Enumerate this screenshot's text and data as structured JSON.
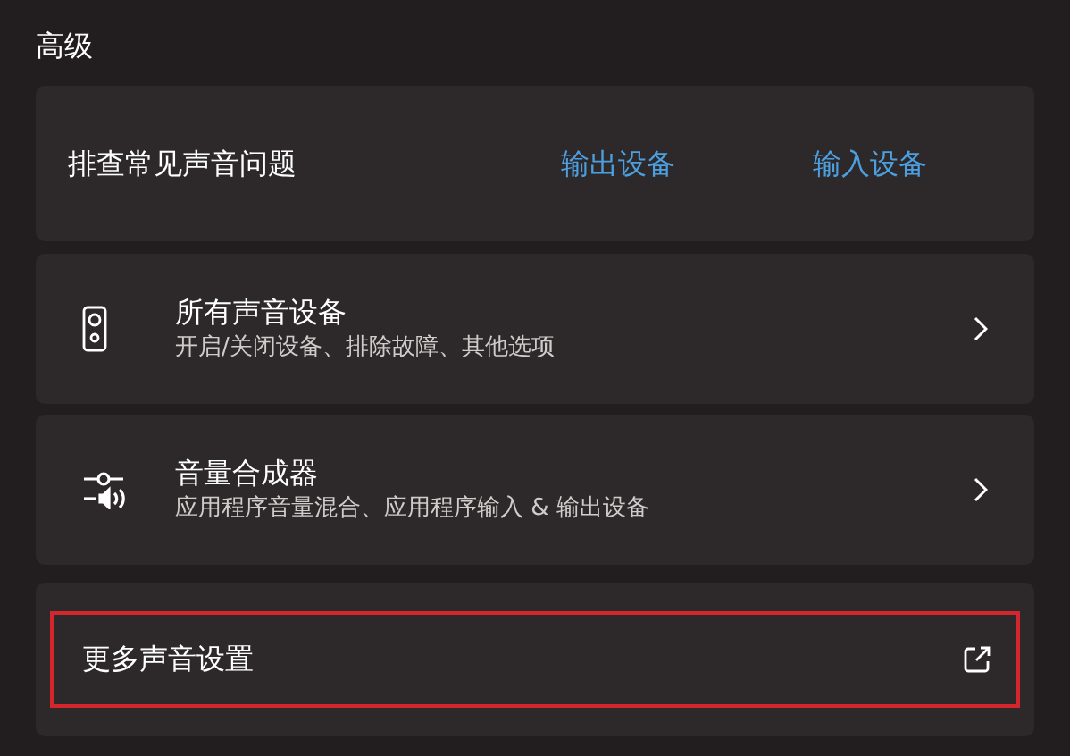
{
  "section_title": "高级",
  "troubleshoot": {
    "label": "排查常见声音问题",
    "links": [
      "输出设备",
      "输入设备"
    ]
  },
  "items": [
    {
      "kind": "speaker",
      "title": "所有声音设备",
      "subtitle": "开启/关闭设备、排除故障、其他选项",
      "highlighted": false
    },
    {
      "kind": "mixer",
      "title": "音量合成器",
      "subtitle": "应用程序音量混合、应用程序输入 & 输出设备",
      "highlighted": false
    },
    {
      "kind": "external",
      "title": "更多声音设置",
      "highlighted": true
    }
  ]
}
